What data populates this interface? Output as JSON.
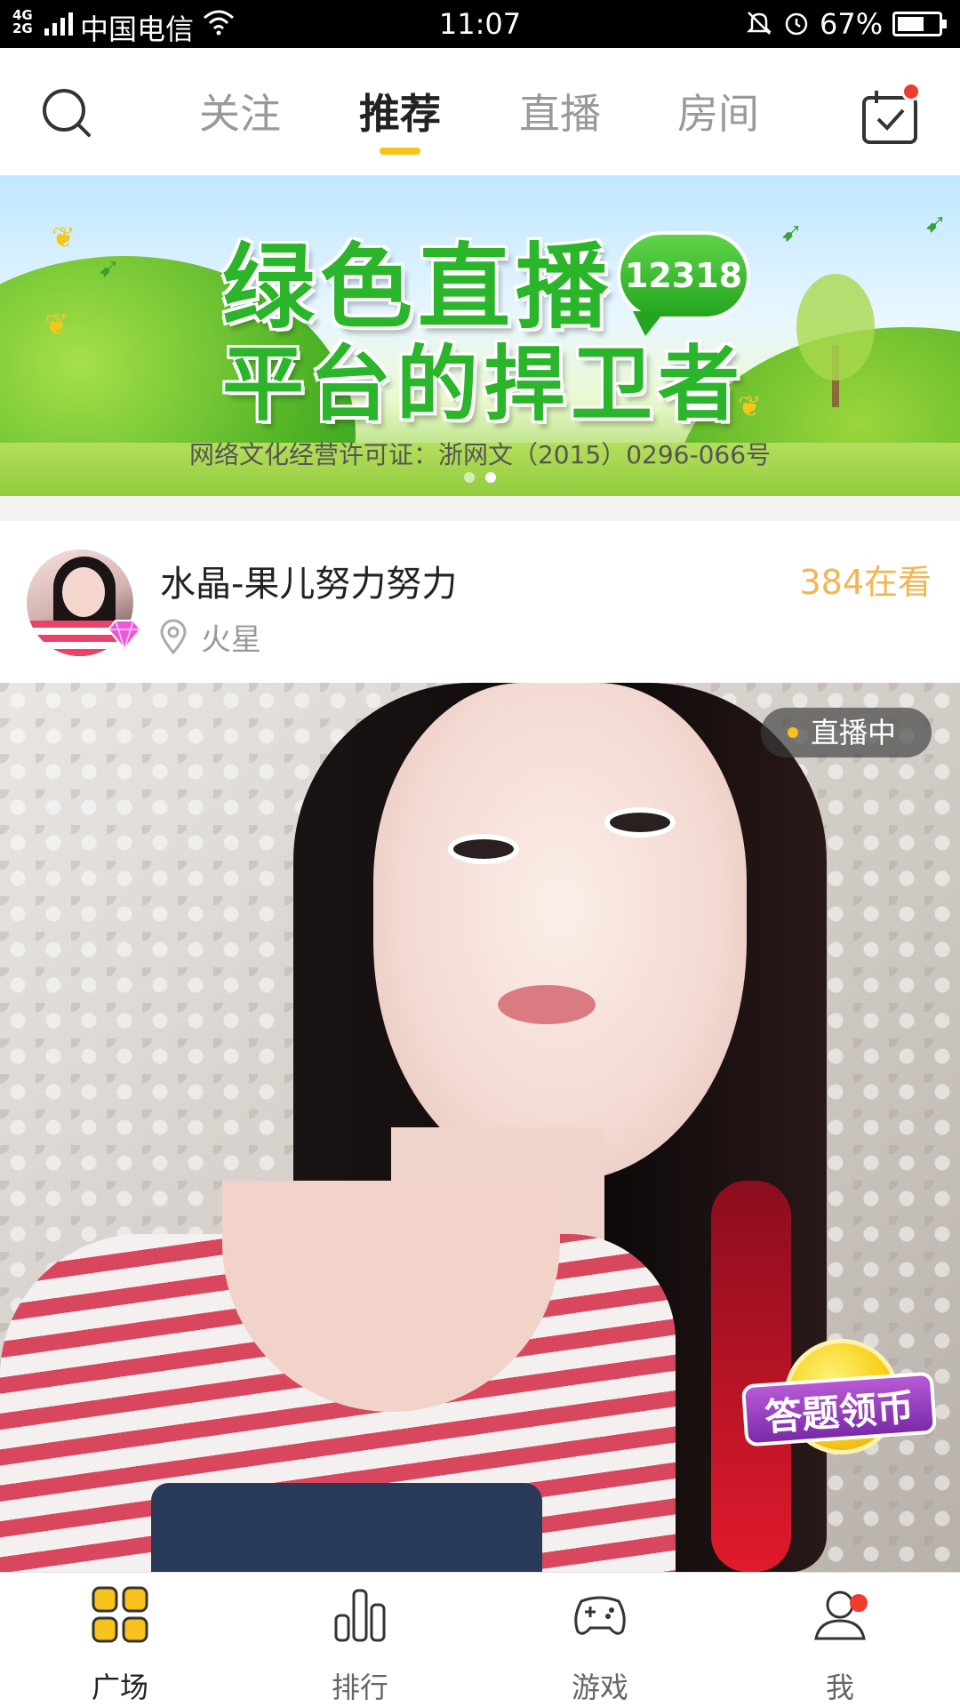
{
  "status_bar": {
    "network": "4G 2G",
    "carrier": "中国电信",
    "time": "11:07",
    "battery_percent": "67%",
    "battery_level": 0.67
  },
  "top_nav": {
    "tabs": [
      {
        "label": "关注",
        "active": false
      },
      {
        "label": "推荐",
        "active": true
      },
      {
        "label": "直播",
        "active": false
      },
      {
        "label": "房间",
        "active": false
      }
    ],
    "accent_color": "#f7c21b",
    "notification_dot_color": "#f03c2e"
  },
  "banner": {
    "title_line1": "绿色直播",
    "title_line2": "平台的捍卫者",
    "badge_number": "12318",
    "license": "网络文化经营许可证：浙网文（2015）0296-066号",
    "page_count": 2,
    "active_page": 2
  },
  "live_card": {
    "streamer_name": "水晶-果儿努力努力",
    "location": "火星",
    "viewers": "384在看",
    "live_status": "直播中",
    "quiz_badge": "答题领币",
    "viewer_color": "#f2b552"
  },
  "bottom_nav": {
    "items": [
      {
        "label": "广场",
        "icon": "square-grid-icon",
        "active": true
      },
      {
        "label": "排行",
        "icon": "bar-chart-icon",
        "active": false
      },
      {
        "label": "游戏",
        "icon": "gamepad-icon",
        "active": false
      },
      {
        "label": "我",
        "icon": "profile-icon",
        "active": false,
        "badge": true
      }
    ]
  }
}
